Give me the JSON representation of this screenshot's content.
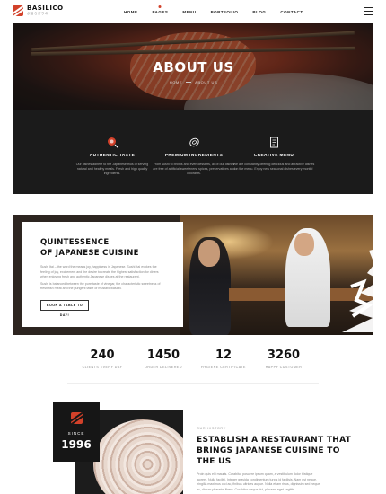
{
  "header": {
    "logo_name": "BASILICO",
    "logo_sub": "ぶるらぎりの",
    "nav": [
      "HOME",
      "PAGES",
      "MENU",
      "PORTFOLIO",
      "BLOG",
      "CONTACT"
    ],
    "active_nav": "PAGES"
  },
  "hero": {
    "title": "ABOUT US",
    "breadcrumb": [
      "HOME",
      "ABOUT US"
    ]
  },
  "features": [
    {
      "icon": "search-dish-icon",
      "title": "AUTHENTIC TASTE",
      "desc": "Our dishes adhere to the Japanese trius of serving natural and healthy meals. Fresh and high quality ingredients."
    },
    {
      "icon": "sushi-roll-icon",
      "title": "PREMIUM INGREDIENTS",
      "desc": "From sushi to broths and even desserts, all of our dishes are free of artificial sweeteners, spices, preservatives and colorants."
    },
    {
      "icon": "menu-card-icon",
      "title": "CREATIVE MENU",
      "desc": "We are constantly offering delicious and attractive dishes on the menu. Enjoy new seasonal dishes every month!"
    }
  ],
  "quint": {
    "title_line1": "QUINTESSENCE",
    "title_line2": "OF JAPANESE CUISINE",
    "paragraphs": [
      "Sushi Itai – the word the means joy, happiness in Japanese. Sushi Itai evokes the feeling of joy, excitement and the desire to create the highest satisfaction for diners when enjoying fresh and authentic Japanese dishes at the restaurant.",
      "Sushi is balanced between the pure taste of vinegar, the characteristic sweetness of fresh fish meat and the pungent taste of mustard wasabi."
    ],
    "button": "BOOK A TABLE TO DAY!"
  },
  "stats": [
    {
      "value": "240",
      "label": "CLIENTS EVERY DAY"
    },
    {
      "value": "1450",
      "label": "ORDER DELIVERED"
    },
    {
      "value": "12",
      "label": "HYGIENE CERTIFICATE"
    },
    {
      "value": "3260",
      "label": "HAPPY CUSTOMER"
    }
  ],
  "since": {
    "label": "SINCE",
    "year": "1996",
    "history_label": "OUR HISTORY",
    "title": "ESTABLISH A RESTAURANT THAT BRINGS JAPANESE CUISINE TO THE US",
    "text": "Proin quis elit mauris. Curabitur posuere ipsum quam, a vestibulum dolor tristique laoreet. Nulla facilisi. Integer gravida condimentum turpis id facilisis. Nam est neque, fringilla maximus orci ac, finibus ultrices augue. Nulla etiam risus, dignissim sed neque ac, dictum pharetra libero. Curabitur neque dui, placerat eget sagittis."
  }
}
